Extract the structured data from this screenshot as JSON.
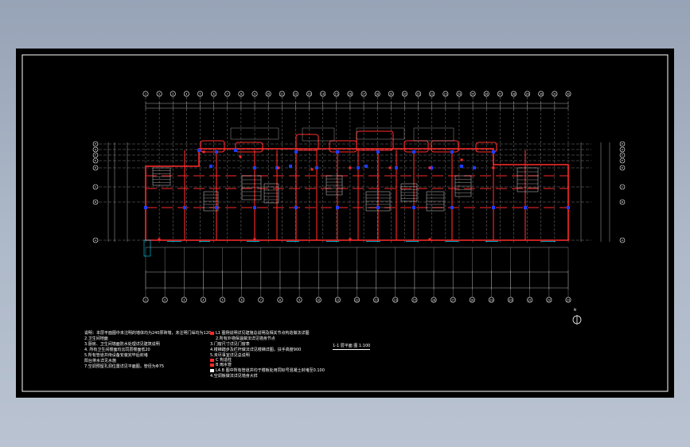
{
  "drawing": {
    "title": "1-1 层平面 图  1:100",
    "north_label": "N"
  },
  "colors": {
    "background": "#000000",
    "frame": "#ffffff",
    "wall": "#ff2a2a",
    "column": "#1f3cff",
    "stair": "#ffffff",
    "dimension": "#d8d8d8",
    "grid_axis": "#cfcfcf",
    "window": "#00d8ff"
  },
  "top_axes": [
    "1",
    "2",
    "3",
    "4",
    "5",
    "6",
    "7",
    "8",
    "9",
    "10",
    "11",
    "12",
    "13",
    "14",
    "15",
    "16",
    "17",
    "18",
    "19",
    "20",
    "21",
    "22",
    "23",
    "24",
    "25",
    "26",
    "27",
    "28",
    "29",
    "30",
    "31",
    "32"
  ],
  "bottom_axes": [
    "1",
    "2",
    "3",
    "4",
    "5",
    "6",
    "7",
    "8",
    "9",
    "10",
    "11",
    "12",
    "13",
    "14",
    "15",
    "16",
    "17",
    "18",
    "19",
    "20",
    "21",
    "22",
    "23"
  ],
  "left_axes": [
    "H",
    "G",
    "F",
    "E",
    "D",
    "C",
    "B",
    "A"
  ],
  "right_axes": [
    "H",
    "G",
    "F",
    "E",
    "D",
    "C",
    "B",
    "A"
  ],
  "notes": [
    "说明：本层平面图中未注明的墙体均为240厚砖墙，未注明门垛均为120",
    "2.卫生间地面",
    "3.厨房、卫生间墙面防水处理详见建筑说明",
    "4.    所有卫生间楼面均比同层楼面低20",
    "5.所有管道井待设备安装完毕后封堵",
    "      阳台排水详见水施",
    "   7.空调预留孔洞位置详见平面图，管径为Φ75"
  ],
  "legend": [
    "L1   图例说明详见建施总说明及相关节点构造做法详图",
    "2.所有外墙保温做法详见墙身节点",
    "3.门窗尺寸详见门窗表",
    "4.楼梯踏步及栏杆做法详见楼梯详图，扶手高度900",
    "5.未尽事宜详见总说明",
    "C   构造柱",
    "B   雨水管",
    "L4.B  图中所有管道井均于楼板处用同标号混凝土封堵至0.100",
    "4.空调板做法详见墙身大样"
  ]
}
